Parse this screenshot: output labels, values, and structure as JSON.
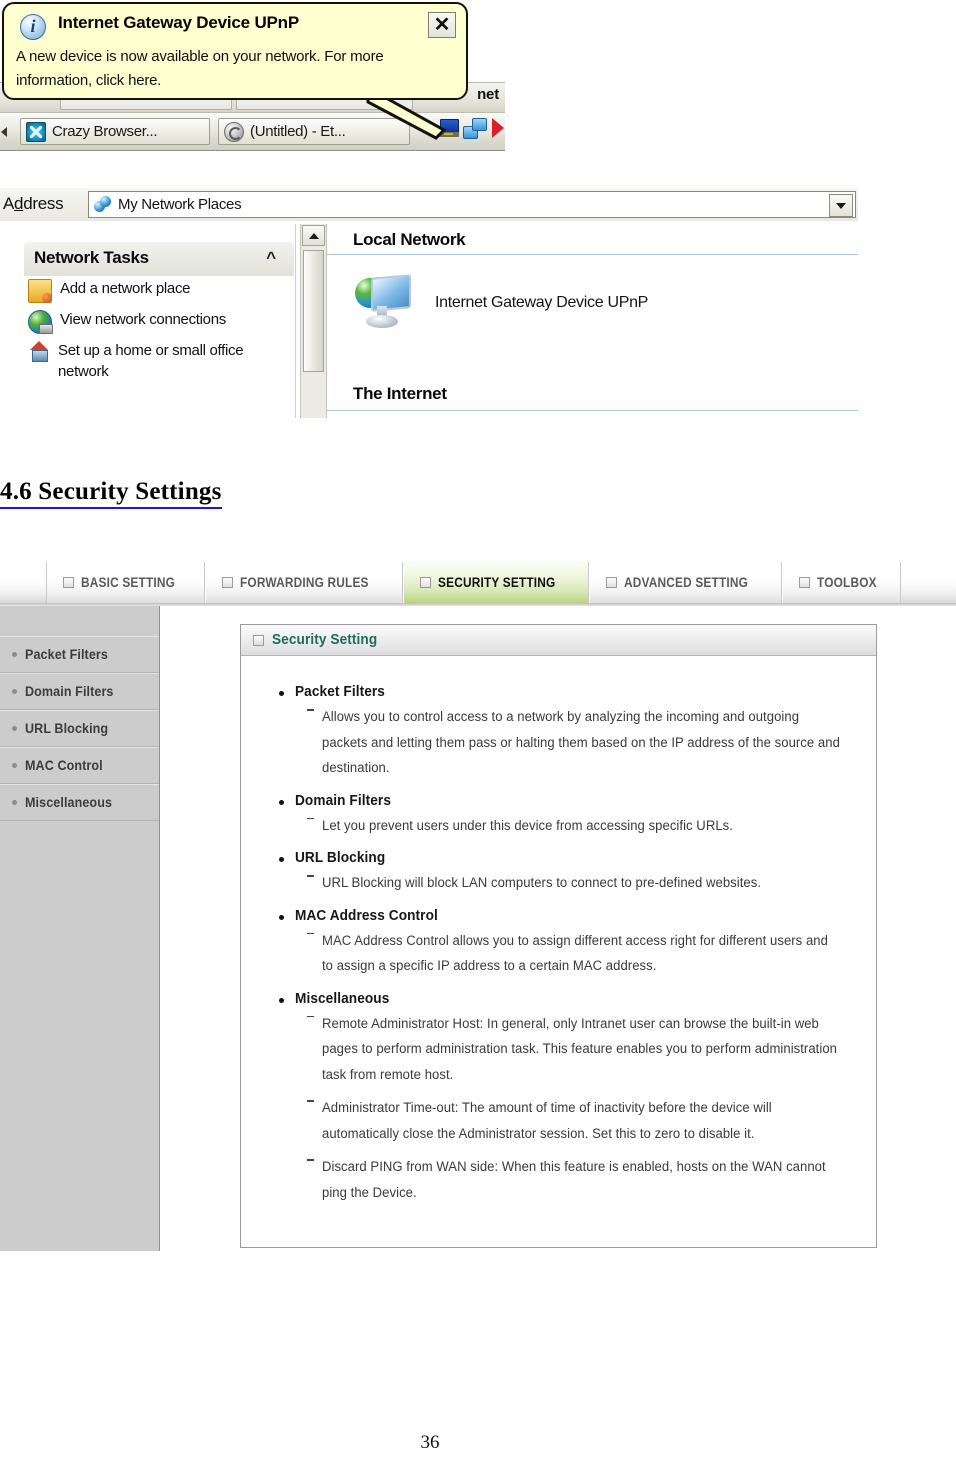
{
  "upnp_notification": {
    "title": "Internet Gateway Device UPnP",
    "body": "A new device is now available on your network. For more information, click here.",
    "close_label": "✕",
    "info_icon": "info-icon",
    "partial_text": "net",
    "taskbar": {
      "items": [
        {
          "label": "Crazy Browser...",
          "icon": "crazy-browser-icon"
        },
        {
          "label": "(Untitled) - Et...",
          "icon": "internet-explorer-icon"
        }
      ],
      "tray": [
        {
          "name": "network-connection-tray-icon"
        },
        {
          "name": "network-computers-tray-icon"
        },
        {
          "name": "red-flag-tray-icon"
        }
      ]
    }
  },
  "explorer": {
    "address_label_pre": "A",
    "address_label_underline": "d",
    "address_label_post": "dress",
    "address_value": "My Network Places",
    "address_icon": "network-places-icon",
    "dropdown_icon": "chevron-down-icon",
    "network_tasks": {
      "title": "Network Tasks",
      "collapse_icon": "chevrons-up-icon",
      "items": [
        {
          "label": "Add a network place",
          "icon": "add-network-place-icon"
        },
        {
          "label": "View network connections",
          "icon": "view-network-connections-icon"
        },
        {
          "label": "Set up a home or small office network",
          "icon": "setup-home-network-icon"
        }
      ]
    },
    "scrollbar": {
      "up_icon": "scroll-up-arrow-icon"
    },
    "groups": [
      {
        "title": "Local Network"
      },
      {
        "title": "The Internet"
      }
    ],
    "device": {
      "label": "Internet Gateway Device UPnP",
      "icon": "upnp-gateway-device-icon"
    }
  },
  "heading": {
    "text": "4.6 Security Settings",
    "underline_color": "#1717e8"
  },
  "router_ui": {
    "tabs": [
      {
        "label": "BASIC SETTING",
        "active": false
      },
      {
        "label": "FORWARDING RULES",
        "active": false
      },
      {
        "label": "SECURITY SETTING",
        "active": true
      },
      {
        "label": "ADVANCED SETTING",
        "active": false
      },
      {
        "label": "TOOLBOX",
        "active": false
      }
    ],
    "active_tab_color": "#d8e8b4",
    "menu": [
      {
        "label": "Packet Filters"
      },
      {
        "label": "Domain Filters"
      },
      {
        "label": "URL Blocking"
      },
      {
        "label": "MAC Control"
      },
      {
        "label": "Miscellaneous"
      }
    ],
    "panel": {
      "title": "Security Setting",
      "title_color": "#1f6b5e",
      "sections": [
        {
          "title": "Packet Filters",
          "items": [
            "Allows you to control access to a network by analyzing the incoming and outgoing packets and letting them pass or halting them based on the IP address of the source and destination."
          ]
        },
        {
          "title": "Domain Filters",
          "items": [
            "Let you prevent users under this device from accessing specific URLs."
          ]
        },
        {
          "title": "URL Blocking",
          "items": [
            "URL Blocking will block LAN computers to connect to pre-defined websites."
          ]
        },
        {
          "title": "MAC Address Control",
          "items": [
            "MAC Address Control allows you to assign different access right for different users and to assign a specific IP address to a certain MAC address."
          ]
        },
        {
          "title": "Miscellaneous",
          "items": [
            "Remote Administrator Host: In general, only Intranet user can browse the built-in web pages to perform administration task. This feature enables you to perform administration task from remote host.",
            "Administrator Time-out: The amount of time of inactivity before the device will automatically close the Administrator session. Set this to zero to disable it.",
            "Discard PING from WAN side: When this feature is enabled, hosts on the WAN cannot ping the Device."
          ]
        }
      ]
    }
  },
  "page_number": "36"
}
